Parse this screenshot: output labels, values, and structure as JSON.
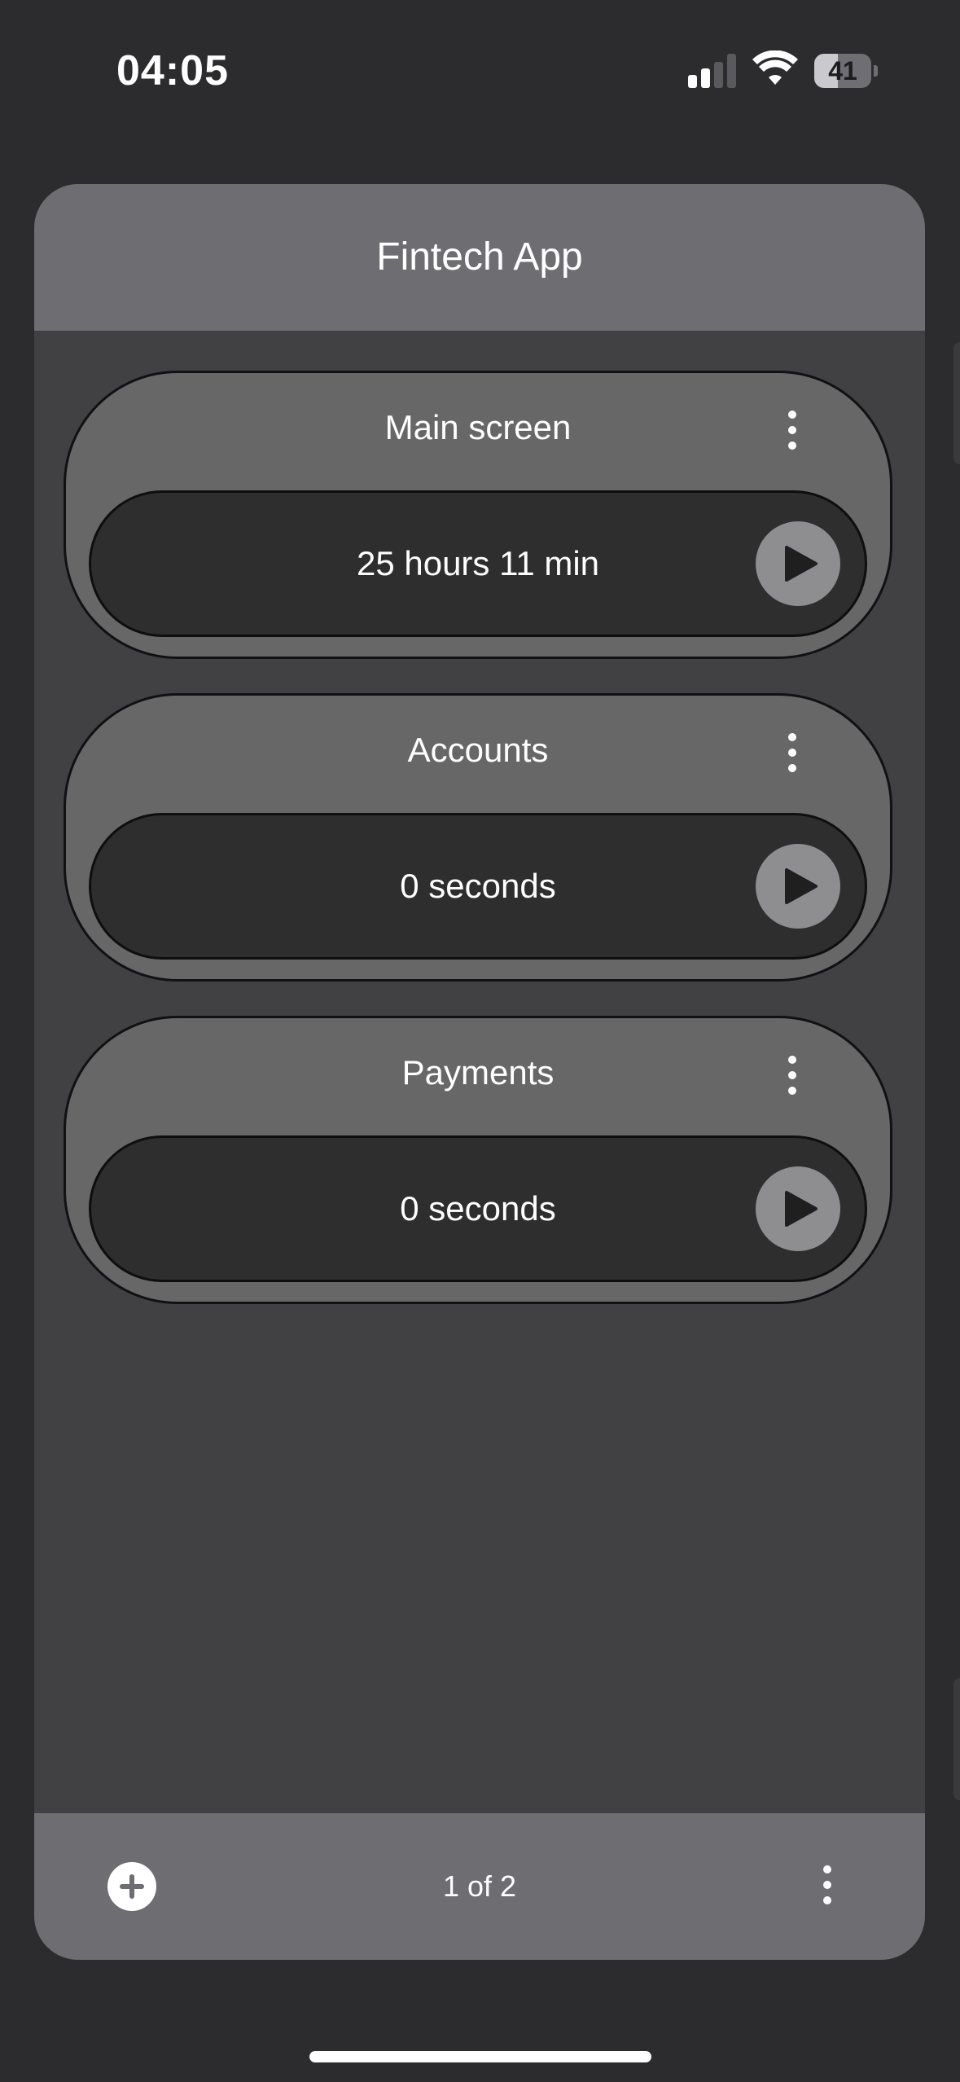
{
  "status_bar": {
    "time": "04:05",
    "battery_level": "41",
    "battery_fraction": 0.41,
    "signal_bars_active": 2,
    "signal_bars_total": 4
  },
  "app": {
    "title": "Fintech App"
  },
  "timers": [
    {
      "name": "Main screen",
      "value": "25 hours 11 min"
    },
    {
      "name": "Accounts",
      "value": "0 seconds"
    },
    {
      "name": "Payments",
      "value": "0 seconds"
    }
  ],
  "footer": {
    "page_indicator": "1 of 2"
  },
  "icons": {
    "signal": "cellular-signal-icon",
    "wifi": "wifi-icon",
    "battery": "battery-icon",
    "more": "kebab-menu-icon",
    "play": "play-icon",
    "add": "plus-circle-icon"
  },
  "colors": {
    "background": "#2c2c2e",
    "card": "#414143",
    "header": "#6d6d72",
    "timer_card": "#676768",
    "timer_pill": "#2e2e2f",
    "play_button": "#8e8e90"
  }
}
